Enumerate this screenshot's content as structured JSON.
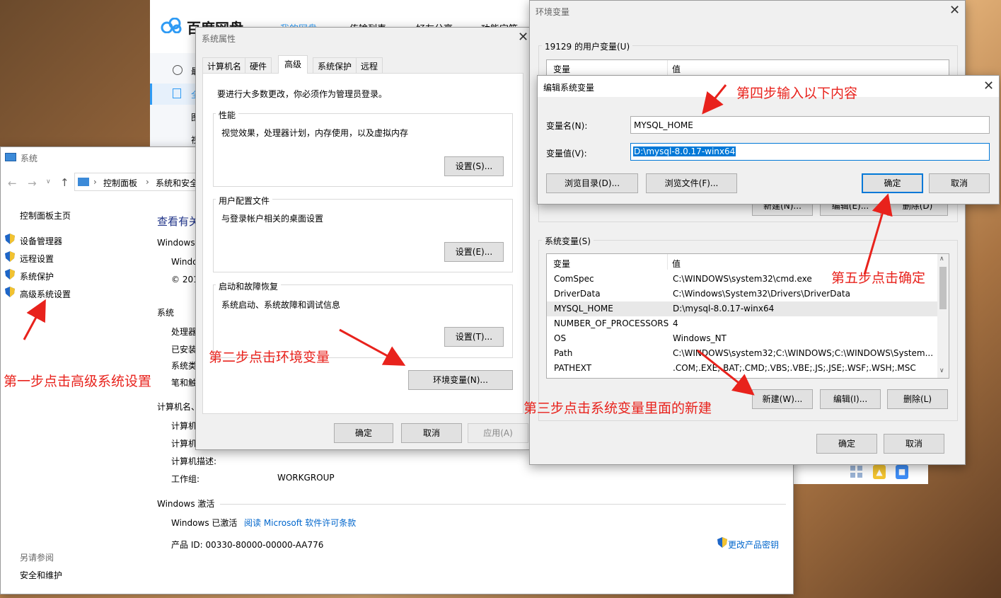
{
  "baidu": {
    "logo": "百度网盘",
    "tabs": [
      "我的网盘",
      "传输列表",
      "好友分享",
      "功能宝箱"
    ],
    "side_items": [
      "最",
      "全",
      "图",
      "视"
    ]
  },
  "system_window": {
    "title": "系统",
    "breadcrumb": [
      "控制面板",
      "系统和安全"
    ],
    "home_link": "控制面板主页",
    "nav_links": [
      "设备管理器",
      "远程设置",
      "系统保护",
      "高级系统设置"
    ],
    "heading": "查看有关",
    "windows_label": "Windows",
    "edition_line1": "Windo",
    "edition_line2": "© 201",
    "section_system": "系统",
    "sys_rows": [
      "处理器",
      "已安装",
      "系统类",
      "笔和触"
    ],
    "section_computer": "计算机名、",
    "comp_rows": [
      "计算机",
      "计算机",
      "计算机描述:",
      "工作组:"
    ],
    "workgroup_value": "WORKGROUP",
    "section_activation": "Windows 激活",
    "activated": "Windows 已激活",
    "license_link": "阅读 Microsoft 软件许可条款",
    "product_id": "产品 ID: 00330-80000-00000-AA776",
    "change_key": "更改产品密钥",
    "see_also": "另请参阅",
    "security_link": "安全和维护"
  },
  "sysprops": {
    "title": "系统属性",
    "tabs": [
      "计算机名",
      "硬件",
      "高级",
      "系统保护",
      "远程"
    ],
    "admin_note": "要进行大多数更改，你必须作为管理员登录。",
    "perf_title": "性能",
    "perf_desc": "视觉效果，处理器计划，内存使用，以及虚拟内存",
    "perf_btn": "设置(S)...",
    "profile_title": "用户配置文件",
    "profile_desc": "与登录帐户相关的桌面设置",
    "profile_btn": "设置(E)...",
    "startup_title": "启动和故障恢复",
    "startup_desc": "系统启动、系统故障和调试信息",
    "startup_btn": "设置(T)...",
    "env_btn": "环境变量(N)...",
    "ok": "确定",
    "cancel": "取消",
    "apply": "应用(A)"
  },
  "envvars": {
    "title": "环境变量",
    "user_section": "19129 的用户变量(U)",
    "col_var": "变量",
    "col_val": "值",
    "user_new": "新建(N)...",
    "user_edit": "编辑(E)...",
    "user_delete": "删除(D)",
    "sys_section": "系统变量(S)",
    "rows": [
      {
        "name": "ComSpec",
        "value": "C:\\WINDOWS\\system32\\cmd.exe"
      },
      {
        "name": "DriverData",
        "value": "C:\\Windows\\System32\\Drivers\\DriverData"
      },
      {
        "name": "MYSQL_HOME",
        "value": "D:\\mysql-8.0.17-winx64"
      },
      {
        "name": "NUMBER_OF_PROCESSORS",
        "value": "4"
      },
      {
        "name": "OS",
        "value": "Windows_NT"
      },
      {
        "name": "Path",
        "value": "C:\\WINDOWS\\system32;C:\\WINDOWS;C:\\WINDOWS\\System..."
      },
      {
        "name": "PATHEXT",
        "value": ".COM;.EXE;.BAT;.CMD;.VBS;.VBE;.JS;.JSE;.WSF;.WSH;.MSC"
      }
    ],
    "sys_new": "新建(W)...",
    "sys_edit": "编辑(I)...",
    "sys_delete": "删除(L)",
    "ok": "确定",
    "cancel": "取消"
  },
  "editvar": {
    "title": "编辑系统变量",
    "name_label": "变量名(N):",
    "name_value": "MYSQL_HOME",
    "value_label": "变量值(V):",
    "value_value": "D:\\mysql-8.0.17-winx64",
    "browse_dir": "浏览目录(D)...",
    "browse_file": "浏览文件(F)...",
    "ok": "确定",
    "cancel": "取消"
  },
  "annotations": {
    "step1": "第一步点击高级系统设置",
    "step2": "第二步点击环境变量",
    "step3": "第三步点击系统变量里面的新建",
    "step4": "第四步输入以下内容",
    "step5": "第五步点击确定"
  },
  "colors": {
    "annotation": "#e8221c",
    "accent": "#0078d7",
    "link": "#0066cc"
  }
}
